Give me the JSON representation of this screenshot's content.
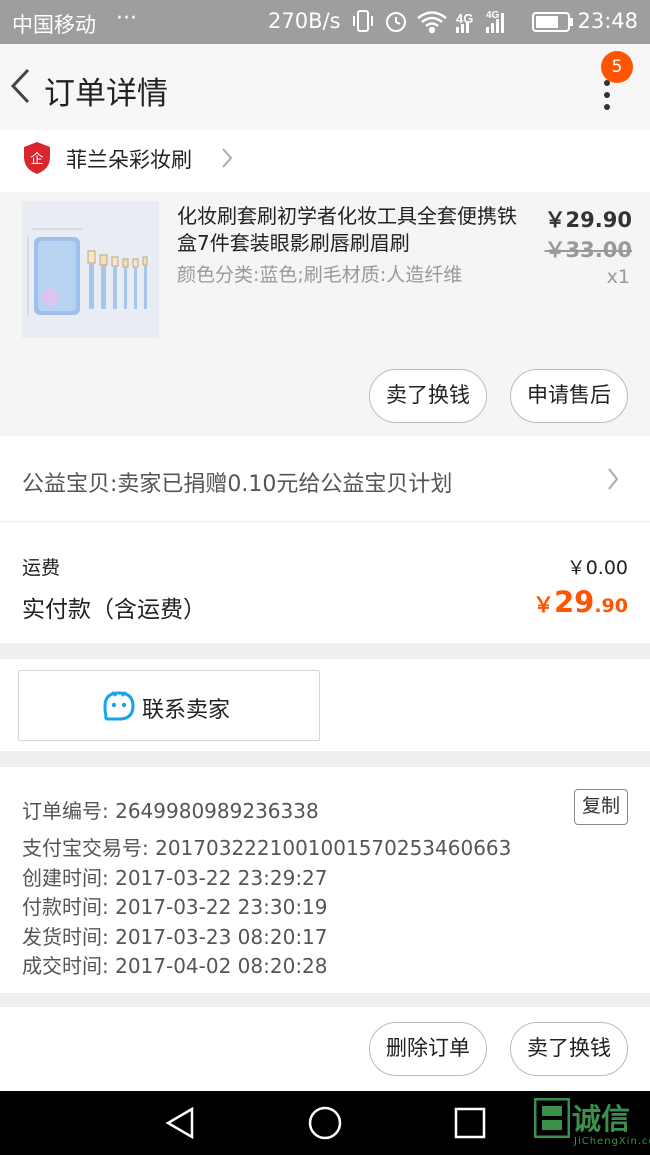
{
  "status_bar": {
    "carrier": "中国移动",
    "dots": "···",
    "net_speed": "270B/s",
    "network": "4G",
    "time": "23:48"
  },
  "header": {
    "title": "订单详情",
    "badge_count": "5"
  },
  "shop": {
    "name": "菲兰朵彩妆刷"
  },
  "product": {
    "title": "化妆刷套刷初学者化妆工具全套便携铁盒7件套装眼影刷唇刷眉刷",
    "spec": "颜色分类:蓝色;刷毛材质:人造纤维",
    "price": "￥29.90",
    "original_price": "￥33.00",
    "quantity": "x1",
    "sell_button": "卖了换钱",
    "after_sale_button": "申请售后"
  },
  "charity": {
    "text": "公益宝贝:卖家已捐赠0.10元给公益宝贝计划"
  },
  "totals": {
    "shipping_label": "运费",
    "shipping_value": "￥0.00",
    "paid_label": "实付款（含运费）",
    "paid_currency": "￥",
    "paid_integer": "29",
    "paid_decimal": ".90"
  },
  "contact": {
    "label": "联系卖家"
  },
  "order_info": {
    "order_no": "订单编号: 2649980989236338",
    "copy_button": "复制",
    "alipay_no": "支付宝交易号: 2017032221001001570253460663",
    "created": "创建时间: 2017-03-22 23:29:27",
    "paid": "付款时间: 2017-03-22 23:30:19",
    "shipped": "发货时间: 2017-03-23 08:20:17",
    "completed": "成交时间: 2017-04-02 08:20:28"
  },
  "actions": {
    "delete_button": "删除订单",
    "sell_button": "卖了换钱"
  },
  "watermark": {
    "text": "诚信",
    "sub": "JiChengXin.com"
  },
  "colors": {
    "accent": "#ff5500",
    "status_bar": "#9e9e9e",
    "contact_icon": "#1aa3e8"
  }
}
